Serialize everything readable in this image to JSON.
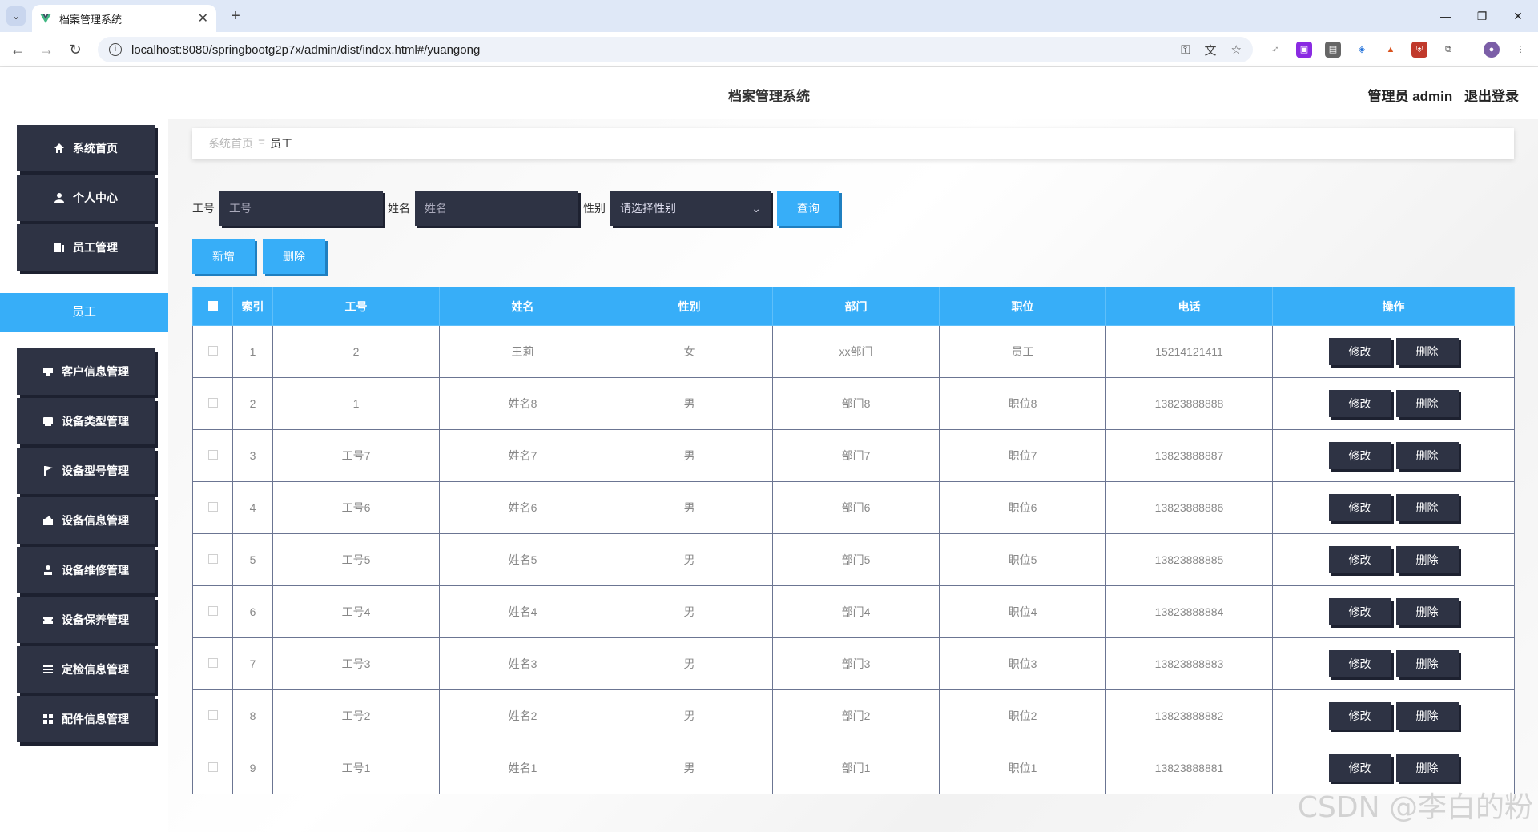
{
  "browser": {
    "tab_title": "档案管理系统",
    "url": "localhost:8080/springbootg2p7x/admin/dist/index.html#/yuangong"
  },
  "header": {
    "title": "档案管理系统",
    "user_label": "管理员 admin",
    "logout": "退出登录"
  },
  "sidebar": {
    "items": [
      {
        "label": "系统首页",
        "icon": "home-icon"
      },
      {
        "label": "个人中心",
        "icon": "user-icon"
      },
      {
        "label": "员工管理",
        "icon": "folder-icon"
      },
      {
        "label": "员工",
        "icon": ""
      },
      {
        "label": "客户信息管理",
        "icon": "card-icon"
      },
      {
        "label": "设备类型管理",
        "icon": "tag-icon"
      },
      {
        "label": "设备型号管理",
        "icon": "flag-icon"
      },
      {
        "label": "设备信息管理",
        "icon": "box-icon"
      },
      {
        "label": "设备维修管理",
        "icon": "person-icon"
      },
      {
        "label": "设备保养管理",
        "icon": "ticket-icon"
      },
      {
        "label": "定检信息管理",
        "icon": "list-icon"
      },
      {
        "label": "配件信息管理",
        "icon": "grid-icon"
      }
    ]
  },
  "breadcrumb": {
    "home": "系统首页",
    "current": "员工"
  },
  "search": {
    "gonghao_label": "工号",
    "gonghao_placeholder": "工号",
    "name_label": "姓名",
    "name_placeholder": "姓名",
    "gender_label": "性别",
    "gender_placeholder": "请选择性别",
    "query_button": "查询"
  },
  "actions": {
    "add": "新增",
    "delete": "删除"
  },
  "table": {
    "columns": [
      "索引",
      "工号",
      "姓名",
      "性别",
      "部门",
      "职位",
      "电话",
      "操作"
    ],
    "rows": [
      {
        "index": "1",
        "gonghao": "2",
        "name": "王莉",
        "gender": "女",
        "dept": "xx部门",
        "position": "员工",
        "phone": "15214121411"
      },
      {
        "index": "2",
        "gonghao": "1",
        "name": "姓名8",
        "gender": "男",
        "dept": "部门8",
        "position": "职位8",
        "phone": "13823888888"
      },
      {
        "index": "3",
        "gonghao": "工号7",
        "name": "姓名7",
        "gender": "男",
        "dept": "部门7",
        "position": "职位7",
        "phone": "13823888887"
      },
      {
        "index": "4",
        "gonghao": "工号6",
        "name": "姓名6",
        "gender": "男",
        "dept": "部门6",
        "position": "职位6",
        "phone": "13823888886"
      },
      {
        "index": "5",
        "gonghao": "工号5",
        "name": "姓名5",
        "gender": "男",
        "dept": "部门5",
        "position": "职位5",
        "phone": "13823888885"
      },
      {
        "index": "6",
        "gonghao": "工号4",
        "name": "姓名4",
        "gender": "男",
        "dept": "部门4",
        "position": "职位4",
        "phone": "13823888884"
      },
      {
        "index": "7",
        "gonghao": "工号3",
        "name": "姓名3",
        "gender": "男",
        "dept": "部门3",
        "position": "职位3",
        "phone": "13823888883"
      },
      {
        "index": "8",
        "gonghao": "工号2",
        "name": "姓名2",
        "gender": "男",
        "dept": "部门2",
        "position": "职位2",
        "phone": "13823888882"
      },
      {
        "index": "9",
        "gonghao": "工号1",
        "name": "姓名1",
        "gender": "男",
        "dept": "部门1",
        "position": "职位1",
        "phone": "13823888881"
      }
    ],
    "edit_label": "修改",
    "delete_label": "删除"
  },
  "watermark": "CSDN @李白的粉",
  "colors": {
    "accent": "#37aef8",
    "dark": "#2e3344"
  }
}
